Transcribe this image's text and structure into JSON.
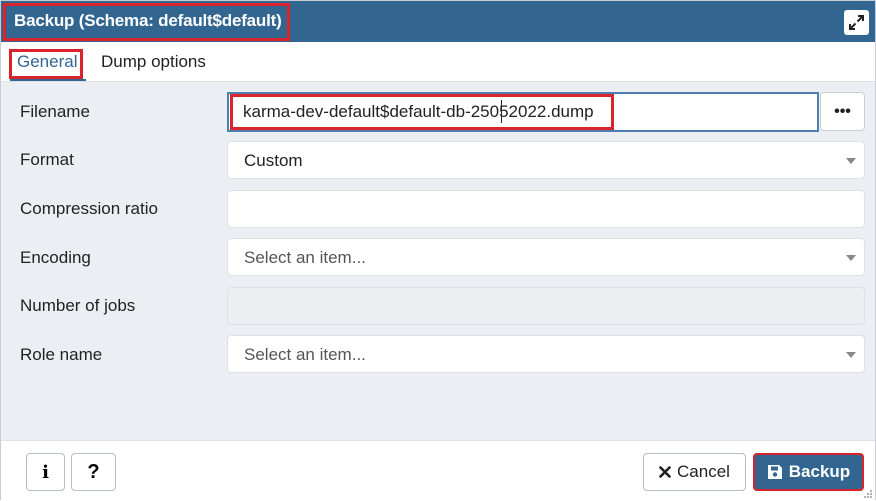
{
  "dialog": {
    "title": "Backup (Schema: default$default)",
    "maximize_icon": "expand-arrows-icon"
  },
  "tabs": [
    {
      "label": "General",
      "active": true
    },
    {
      "label": "Dump options",
      "active": false
    }
  ],
  "form": {
    "filename": {
      "label": "Filename",
      "value": "karma-dev-default$default-db-25052022.dump",
      "browse_label": "•••"
    },
    "format": {
      "label": "Format",
      "value": "Custom"
    },
    "compression": {
      "label": "Compression ratio",
      "value": ""
    },
    "encoding": {
      "label": "Encoding",
      "placeholder": "Select an item..."
    },
    "jobs": {
      "label": "Number of jobs",
      "value": ""
    },
    "role": {
      "label": "Role name",
      "placeholder": "Select an item..."
    }
  },
  "footer": {
    "info_label": "i",
    "help_label": "?",
    "cancel_label": "Cancel",
    "backup_label": "Backup"
  },
  "colors": {
    "accent": "#326690",
    "highlight": "#d9232e"
  }
}
